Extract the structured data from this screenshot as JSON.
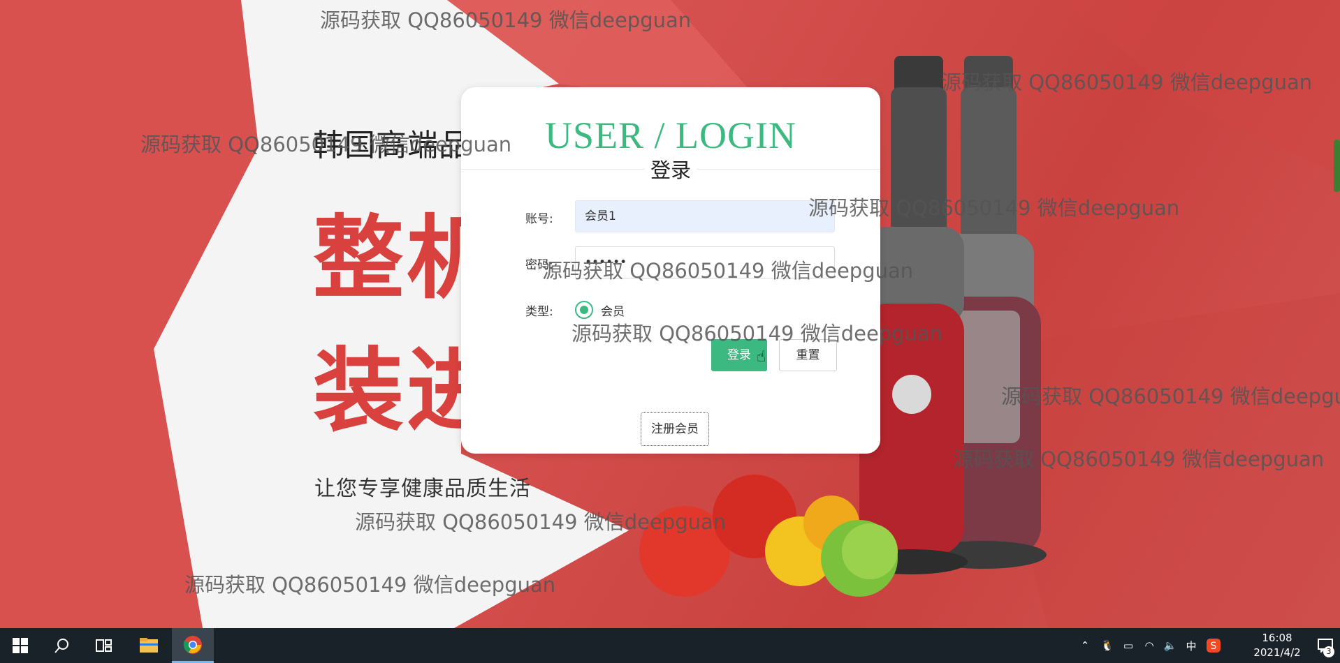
{
  "login": {
    "title": "USER / LOGIN",
    "subtitle": "登录",
    "account_label": "账号:",
    "account_value": "会员1",
    "password_label": "密码:",
    "password_value": "••••••",
    "type_label": "类型:",
    "type_option": "会员",
    "login_button": "登录",
    "reset_button": "重置",
    "register_button": "注册会员"
  },
  "background": {
    "headline": "韩国高端品牌",
    "big_line1": "整机原",
    "big_line2": "装进口",
    "subline": "让您专享健康品质生活"
  },
  "watermark_text": "源码获取 QQ86050149 微信deepguan",
  "taskbar": {
    "time": "16:08",
    "date": "2021/4/2",
    "ime": "中",
    "notifications": "3"
  },
  "colors": {
    "accent": "#3bb980",
    "background_red": "#d9514f"
  }
}
